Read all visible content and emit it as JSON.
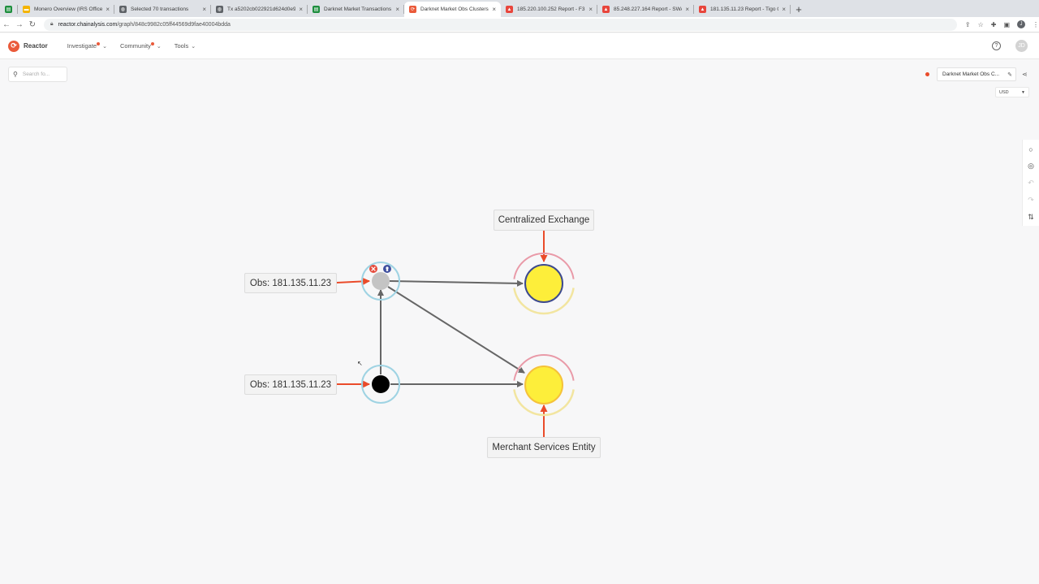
{
  "browser": {
    "tabs": [
      {
        "title": "",
        "icon": "sheets-icon",
        "color": "#1e8e3e",
        "active": false
      },
      {
        "title": "Monero Overview (IRS Office",
        "icon": "folder-icon",
        "color": "#f4b400",
        "active": false
      },
      {
        "title": "Selected 70 transactions",
        "icon": "globe-icon",
        "color": "#5f6368",
        "active": false
      },
      {
        "title": "Tx a5202cb022921d624d0e9",
        "icon": "globe-icon",
        "color": "#5f6368",
        "active": false
      },
      {
        "title": "Darknet Market Transactions",
        "icon": "sheets-icon",
        "color": "#1e8e3e",
        "active": false
      },
      {
        "title": "Darknet Market Obs Clusters",
        "icon": "reactor-icon",
        "color": "#ea5a3a",
        "active": true
      },
      {
        "title": "185.220.100.252 Report - F3",
        "icon": "report-icon",
        "color": "#e8453c",
        "active": false
      },
      {
        "title": "85.248.227.164 Report - SWA",
        "icon": "report-icon",
        "color": "#e8453c",
        "active": false
      },
      {
        "title": "181.135.11.23 Report - Tigo Co",
        "icon": "report-icon",
        "color": "#e8453c",
        "active": false
      }
    ],
    "url_host": "reactor.chainalysis.com",
    "url_path": "/graph/848c9982c05ff44569d9fae40004bdda",
    "profile_initial": "J"
  },
  "app": {
    "name": "Reactor",
    "menu": {
      "investigate": "Investigate",
      "community": "Community",
      "tools": "Tools"
    },
    "avatar_initial": "JD"
  },
  "canvas": {
    "search_placeholder": "Search fo...",
    "graph_title": "Darknet Market Obs C...",
    "currency": "USD",
    "status_color": "#ea4b2a"
  },
  "graph": {
    "labels": {
      "exchange": "Centralized Exchange",
      "merchant": "Merchant Services Entity",
      "obs_top": "Obs: 181.135.11.23",
      "obs_bottom": "Obs: 181.135.11.23"
    },
    "colors": {
      "edge": "#666666",
      "label_arrow": "#ea4b2a",
      "cluster_fill": "#fdee3a",
      "ring_blue": "#9fd3e3",
      "ring_red": "#e99aa8",
      "ring_yellow": "#f2e5a0"
    }
  }
}
